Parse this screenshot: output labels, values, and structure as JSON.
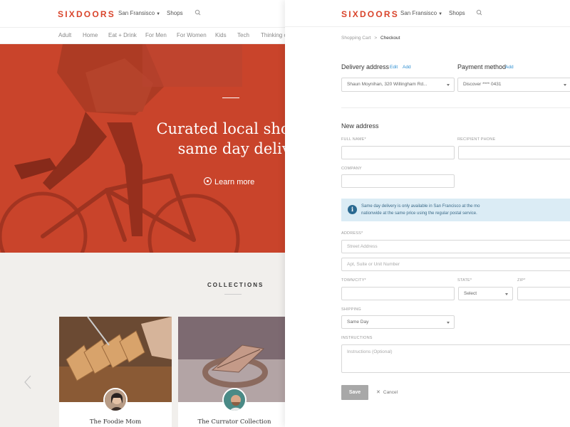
{
  "brand": {
    "name": "SIXDOORS",
    "color": "#d9442b"
  },
  "left_header": {
    "city": "San Fransisco",
    "shops": "Shops",
    "search_icon": "search-icon"
  },
  "categories": [
    "Adult",
    "Home",
    "Eat + Drink",
    "For Men",
    "For Women",
    "Kids",
    "Tech",
    "Thinking o"
  ],
  "hero": {
    "title": "Curated local shop\nsame day delive",
    "cta": "Learn more"
  },
  "collections": {
    "heading": "COLLECTIONS",
    "cards": [
      {
        "title": "The Foodie Mom"
      },
      {
        "title": "The Currator Collection"
      }
    ]
  },
  "right_header": {
    "city": "San Fransisco",
    "shops": "Shops"
  },
  "breadcrumb": {
    "parent": "Shopping Cart",
    "separator": ">",
    "current": "Checkout"
  },
  "delivery": {
    "title": "Delivery address",
    "edit": "Edit",
    "add": "Add",
    "selected": "Shaun Moynihan, 320 Willingham Rd..."
  },
  "payment": {
    "title": "Payment method",
    "add": "Add",
    "selected": "Discover **** 0431"
  },
  "new_address": {
    "title": "New address",
    "full_name_label": "FULL NAME*",
    "recipient_phone_label": "RECIPIENT PHONE",
    "company_label": "COMPANY",
    "notice_line1": "Same day delivery is only available in San Francisco at the mo",
    "notice_line2": "nationwide at the same price using the regular postal service.",
    "address_label": "ADDRESS*",
    "street_placeholder": "Street Address",
    "apt_placeholder": "Apt, Suite or Unit Number",
    "town_label": "TOWN/CITY*",
    "state_label": "STATE*",
    "state_value": "Select",
    "zip_label": "ZIP*",
    "shipping_label": "SHIPPING",
    "shipping_value": "Same Day",
    "instructions_label": "INSTRUCTIONS",
    "instructions_placeholder": "Instructions (Optional)"
  },
  "actions": {
    "save": "Save",
    "cancel": "Cancel"
  }
}
